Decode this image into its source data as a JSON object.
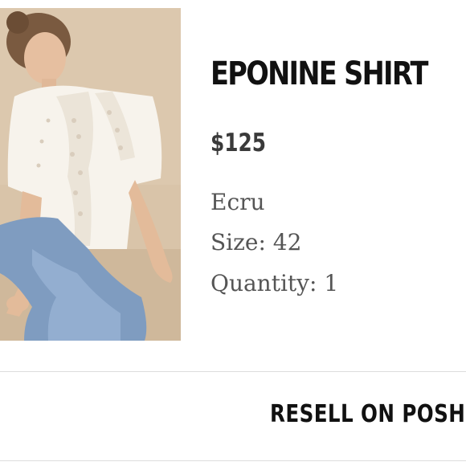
{
  "product": {
    "name": "EPONINE SHIRT",
    "price": "$125",
    "color": "Ecru",
    "size": "Size: 42",
    "quantity": "Quantity: 1",
    "image_icon": "product-photo"
  },
  "actions": {
    "resell_label": "RESELL ON POSHMARK"
  },
  "colors": {
    "text_primary": "#111111",
    "text_secondary": "#555555",
    "divider": "#dddddd",
    "background": "#ffffff"
  }
}
